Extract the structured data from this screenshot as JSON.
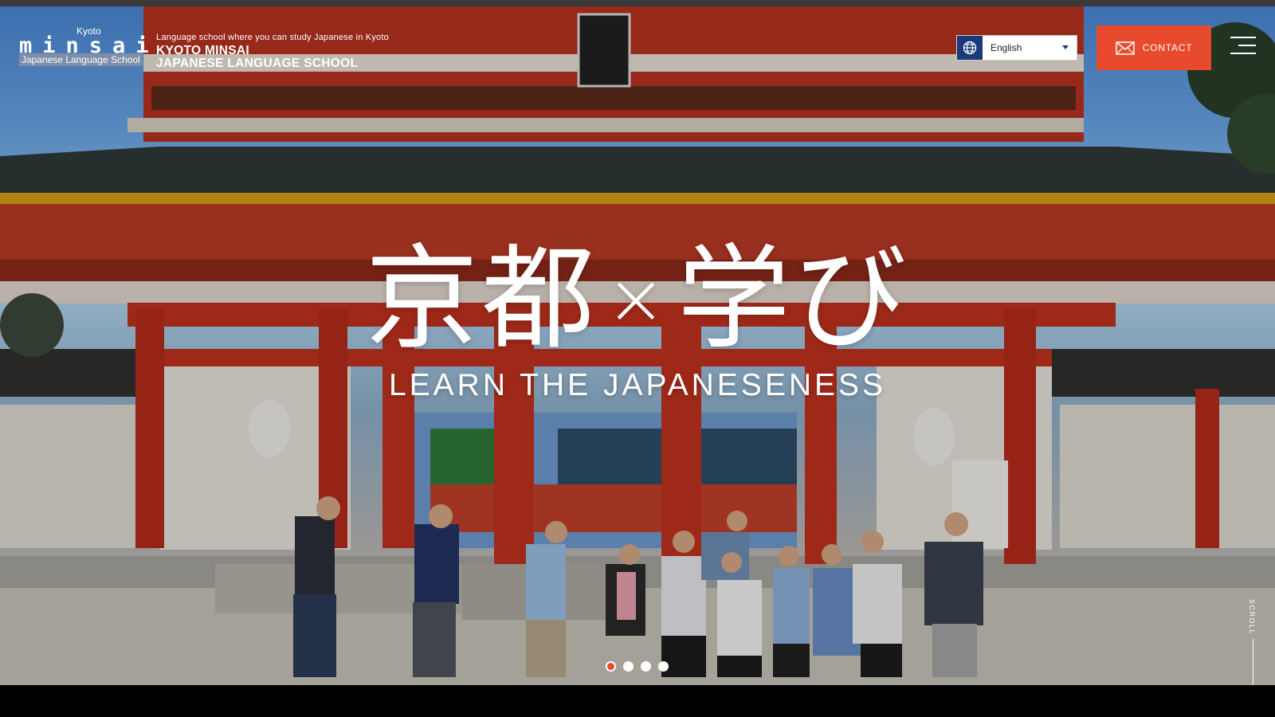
{
  "header": {
    "logo": {
      "word": "minsai",
      "city": "Kyoto",
      "subtitle": "Japanese Language School"
    },
    "tagline": "Language school where you can study Japanese in Kyoto",
    "school_name_line1": "KYOTO MINSAI",
    "school_name_line2": "JAPANESE LANGUAGE SCHOOL",
    "language": {
      "selected": "English",
      "icon": "globe-icon"
    },
    "contact_label": "CONTACT",
    "contact_icon": "envelope-icon",
    "menu_icon": "hamburger-menu-icon"
  },
  "hero": {
    "headline_jp_left": "京都",
    "headline_jp_cross": "×",
    "headline_jp_right": "学び",
    "headline_en": "LEARN THE JAPANESENESS",
    "slider": {
      "slides": 4,
      "active_index": 0
    },
    "scroll_label": "SCROLL"
  },
  "colors": {
    "accent": "#e84a2e",
    "globe_bg": "#1a3a7a",
    "gate_red": "#c3321f"
  }
}
